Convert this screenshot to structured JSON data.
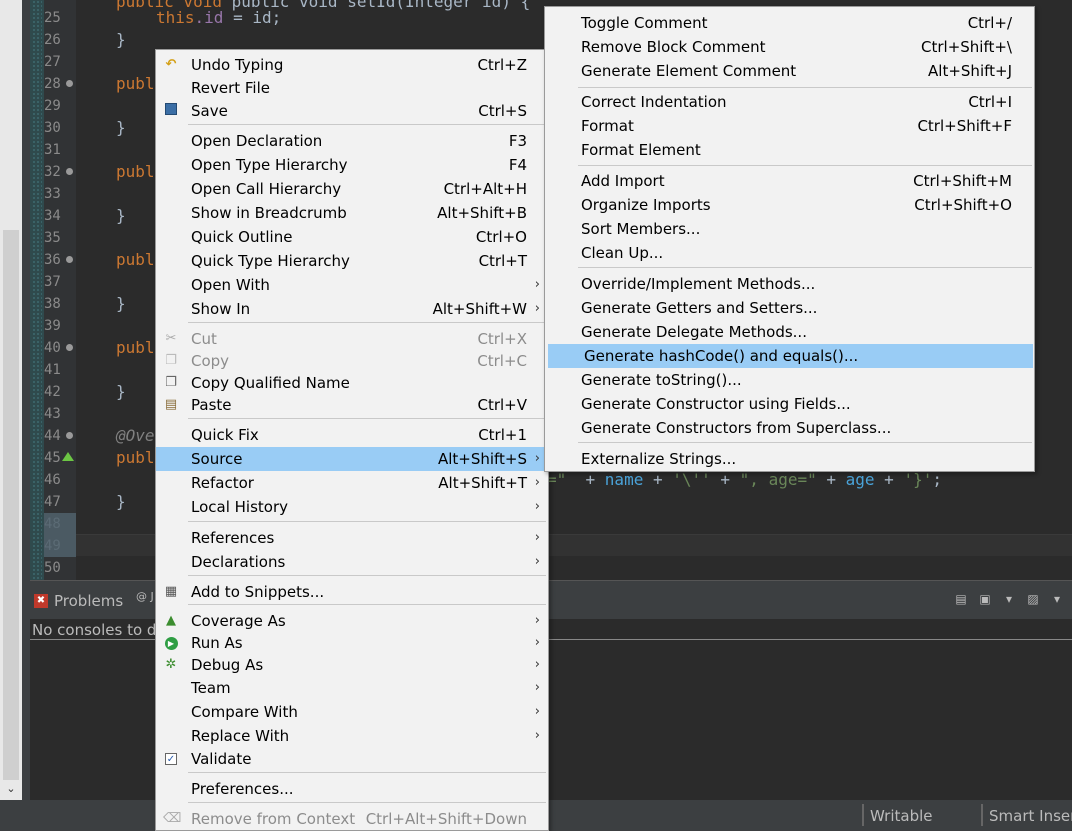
{
  "editor": {
    "line_numbers": [
      "25",
      "26",
      "27",
      "28",
      "29",
      "30",
      "31",
      "32",
      "33",
      "34",
      "35",
      "36",
      "37",
      "38",
      "39",
      "40",
      "41",
      "42",
      "43",
      "44",
      "45",
      "46",
      "47",
      "48",
      "49",
      "50"
    ],
    "lines": {
      "l24": "public void setId(Integer id) {",
      "l25_kw": "this",
      "l25_rest": ".id",
      "l25_tail": " = id;",
      "l26": "}",
      "l28": "publ",
      "l30": "}",
      "l32": "publ",
      "l34": "}",
      "l36": "publ",
      "l38": "}",
      "l40": "publ",
      "l42": "}",
      "l44": "@Ove",
      "l45": "publ",
      "l47": "}",
      "l46_visible": "=\"  + name + '\\'' + \", age=\" + age + '}';"
    }
  },
  "context_menu": {
    "items": [
      {
        "label": "Undo Typing",
        "shortcut": "Ctrl+Z",
        "icon": "undo-icon"
      },
      {
        "label": "Revert File",
        "shortcut": ""
      },
      {
        "label": "Save",
        "shortcut": "Ctrl+S",
        "icon": "save-icon"
      },
      {
        "label": "Open Declaration",
        "shortcut": "F3"
      },
      {
        "label": "Open Type Hierarchy",
        "shortcut": "F4"
      },
      {
        "label": "Open Call Hierarchy",
        "shortcut": "Ctrl+Alt+H"
      },
      {
        "label": "Show in Breadcrumb",
        "shortcut": "Alt+Shift+B"
      },
      {
        "label": "Quick Outline",
        "shortcut": "Ctrl+O"
      },
      {
        "label": "Quick Type Hierarchy",
        "shortcut": "Ctrl+T"
      },
      {
        "label": "Open With",
        "shortcut": ""
      },
      {
        "label": "Show In",
        "shortcut": "Alt+Shift+W"
      },
      {
        "label": "Cut",
        "shortcut": "Ctrl+X",
        "icon": "cut-icon"
      },
      {
        "label": "Copy",
        "shortcut": "Ctrl+C",
        "icon": "copy-icon"
      },
      {
        "label": "Copy Qualified Name",
        "shortcut": "",
        "icon": "copy-qualified-icon"
      },
      {
        "label": "Paste",
        "shortcut": "Ctrl+V",
        "icon": "paste-icon"
      },
      {
        "label": "Quick Fix",
        "shortcut": "Ctrl+1"
      },
      {
        "label": "Source",
        "shortcut": "Alt+Shift+S"
      },
      {
        "label": "Refactor",
        "shortcut": "Alt+Shift+T"
      },
      {
        "label": "Local History",
        "shortcut": ""
      },
      {
        "label": "References",
        "shortcut": ""
      },
      {
        "label": "Declarations",
        "shortcut": ""
      },
      {
        "label": "Add to Snippets...",
        "shortcut": "",
        "icon": "snippet-icon"
      },
      {
        "label": "Coverage As",
        "shortcut": "",
        "icon": "coverage-icon"
      },
      {
        "label": "Run As",
        "shortcut": "",
        "icon": "run-icon"
      },
      {
        "label": "Debug As",
        "shortcut": "",
        "icon": "debug-icon"
      },
      {
        "label": "Team",
        "shortcut": ""
      },
      {
        "label": "Compare With",
        "shortcut": ""
      },
      {
        "label": "Replace With",
        "shortcut": ""
      },
      {
        "label": "Validate",
        "shortcut": "",
        "icon": "validate-check-icon"
      },
      {
        "label": "Preferences...",
        "shortcut": ""
      },
      {
        "label": "Remove from Context",
        "shortcut": "Ctrl+Alt+Shift+Down",
        "icon": "remove-context-icon"
      }
    ],
    "arrow": "›"
  },
  "source_menu": {
    "items": [
      {
        "label": "Toggle Comment",
        "shortcut": "Ctrl+/"
      },
      {
        "label": "Remove Block Comment",
        "shortcut": "Ctrl+Shift+\\"
      },
      {
        "label": "Generate Element Comment",
        "shortcut": "Alt+Shift+J"
      },
      {
        "label": "Correct Indentation",
        "shortcut": "Ctrl+I"
      },
      {
        "label": "Format",
        "shortcut": "Ctrl+Shift+F"
      },
      {
        "label": "Format Element",
        "shortcut": ""
      },
      {
        "label": "Add Import",
        "shortcut": "Ctrl+Shift+M"
      },
      {
        "label": "Organize Imports",
        "shortcut": "Ctrl+Shift+O"
      },
      {
        "label": "Sort Members...",
        "shortcut": ""
      },
      {
        "label": "Clean Up...",
        "shortcut": ""
      },
      {
        "label": "Override/Implement Methods...",
        "shortcut": ""
      },
      {
        "label": "Generate Getters and Setters...",
        "shortcut": ""
      },
      {
        "label": "Generate Delegate Methods...",
        "shortcut": ""
      },
      {
        "label": "Generate hashCode() and equals()...",
        "shortcut": ""
      },
      {
        "label": "Generate toString()...",
        "shortcut": ""
      },
      {
        "label": "Generate Constructor using Fields...",
        "shortcut": ""
      },
      {
        "label": "Generate Constructors from Superclass...",
        "shortcut": ""
      },
      {
        "label": "Externalize Strings...",
        "shortcut": ""
      }
    ]
  },
  "panel": {
    "tab_problems": "Problems",
    "tab_other": "@ J",
    "console_message": "No consoles to d"
  },
  "statusbar": {
    "writable": "Writable",
    "insert_mode": "Smart Inser"
  },
  "colors": {
    "menu_bg": "#f2f2f2",
    "menu_selected": "#99ccf5",
    "editor_bg": "#2b2b2b",
    "keyword": "#cc7832",
    "field": "#9876aa"
  }
}
